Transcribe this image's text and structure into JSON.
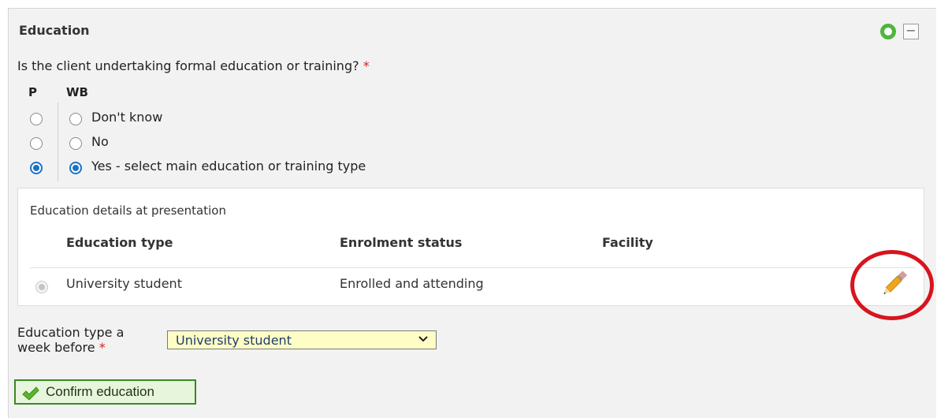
{
  "section": {
    "title": "Education",
    "status_icon": "status-circle-green",
    "collapse_symbol": "−"
  },
  "question": {
    "text": "Is the client undertaking formal education or training?",
    "required_marker": "*",
    "columns": [
      "P",
      "WB"
    ],
    "options": [
      {
        "label": "Don't know",
        "p_selected": false,
        "wb_selected": false
      },
      {
        "label": "No",
        "p_selected": false,
        "wb_selected": false
      },
      {
        "label": "Yes - select main education or training type",
        "p_selected": true,
        "wb_selected": true
      }
    ]
  },
  "details": {
    "title": "Education details at presentation",
    "headers": [
      "Education type",
      "Enrolment status",
      "Facility"
    ],
    "rows": [
      {
        "education_type": "University student",
        "enrolment_status": "Enrolled and attending",
        "facility": ""
      }
    ],
    "edit_icon": "pencil-icon",
    "highlight_color": "#d8141e"
  },
  "week_before": {
    "label_line1": "Education type a",
    "label_line2": "week before",
    "required_marker": "*",
    "selected_value": "University student"
  },
  "confirm_button": {
    "label": "Confirm education",
    "icon": "check-icon"
  },
  "colors": {
    "accent_blue": "#1a73c9",
    "status_green": "#4fb63c",
    "required_red": "#d21f1f",
    "select_bg": "#fefdc5",
    "confirm_bg": "#e7f5dd"
  }
}
